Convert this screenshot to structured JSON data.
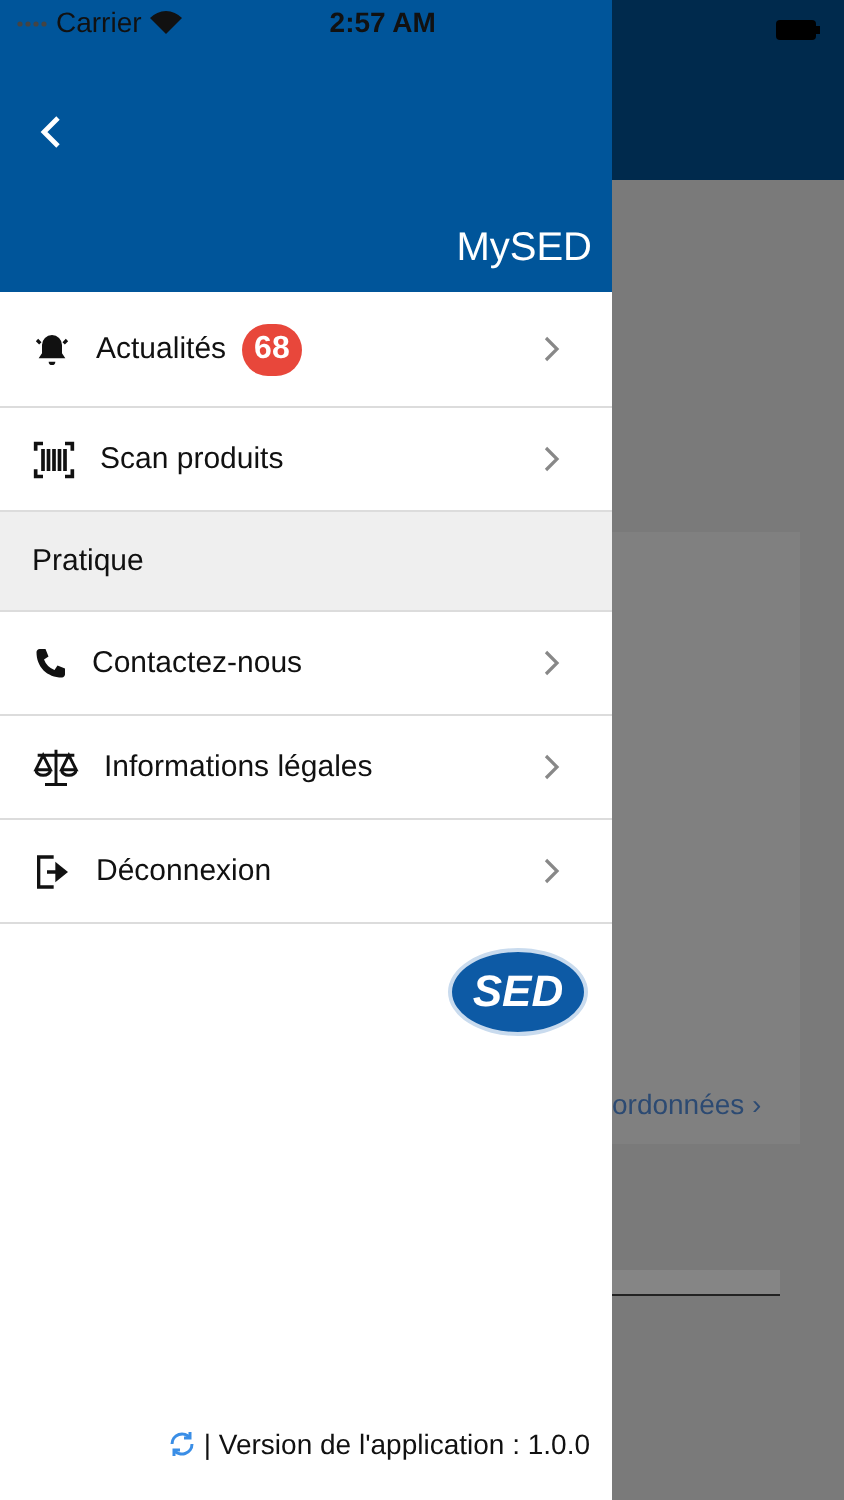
{
  "status_bar": {
    "carrier": "Carrier",
    "time": "2:57 AM"
  },
  "drawer": {
    "title": "MySED",
    "items": [
      {
        "kind": "item",
        "label": "Actualités",
        "badge": "68"
      },
      {
        "kind": "item",
        "label": "Scan produits"
      },
      {
        "kind": "section",
        "label": "Pratique"
      },
      {
        "kind": "item",
        "label": "Contactez-nous"
      },
      {
        "kind": "item",
        "label": "Informations légales"
      },
      {
        "kind": "item",
        "label": "Déconnexion"
      }
    ],
    "logo": "SED",
    "footer": "| Version de l'application : 1.0.0"
  },
  "background": {
    "link": "ordonnées ›"
  }
}
